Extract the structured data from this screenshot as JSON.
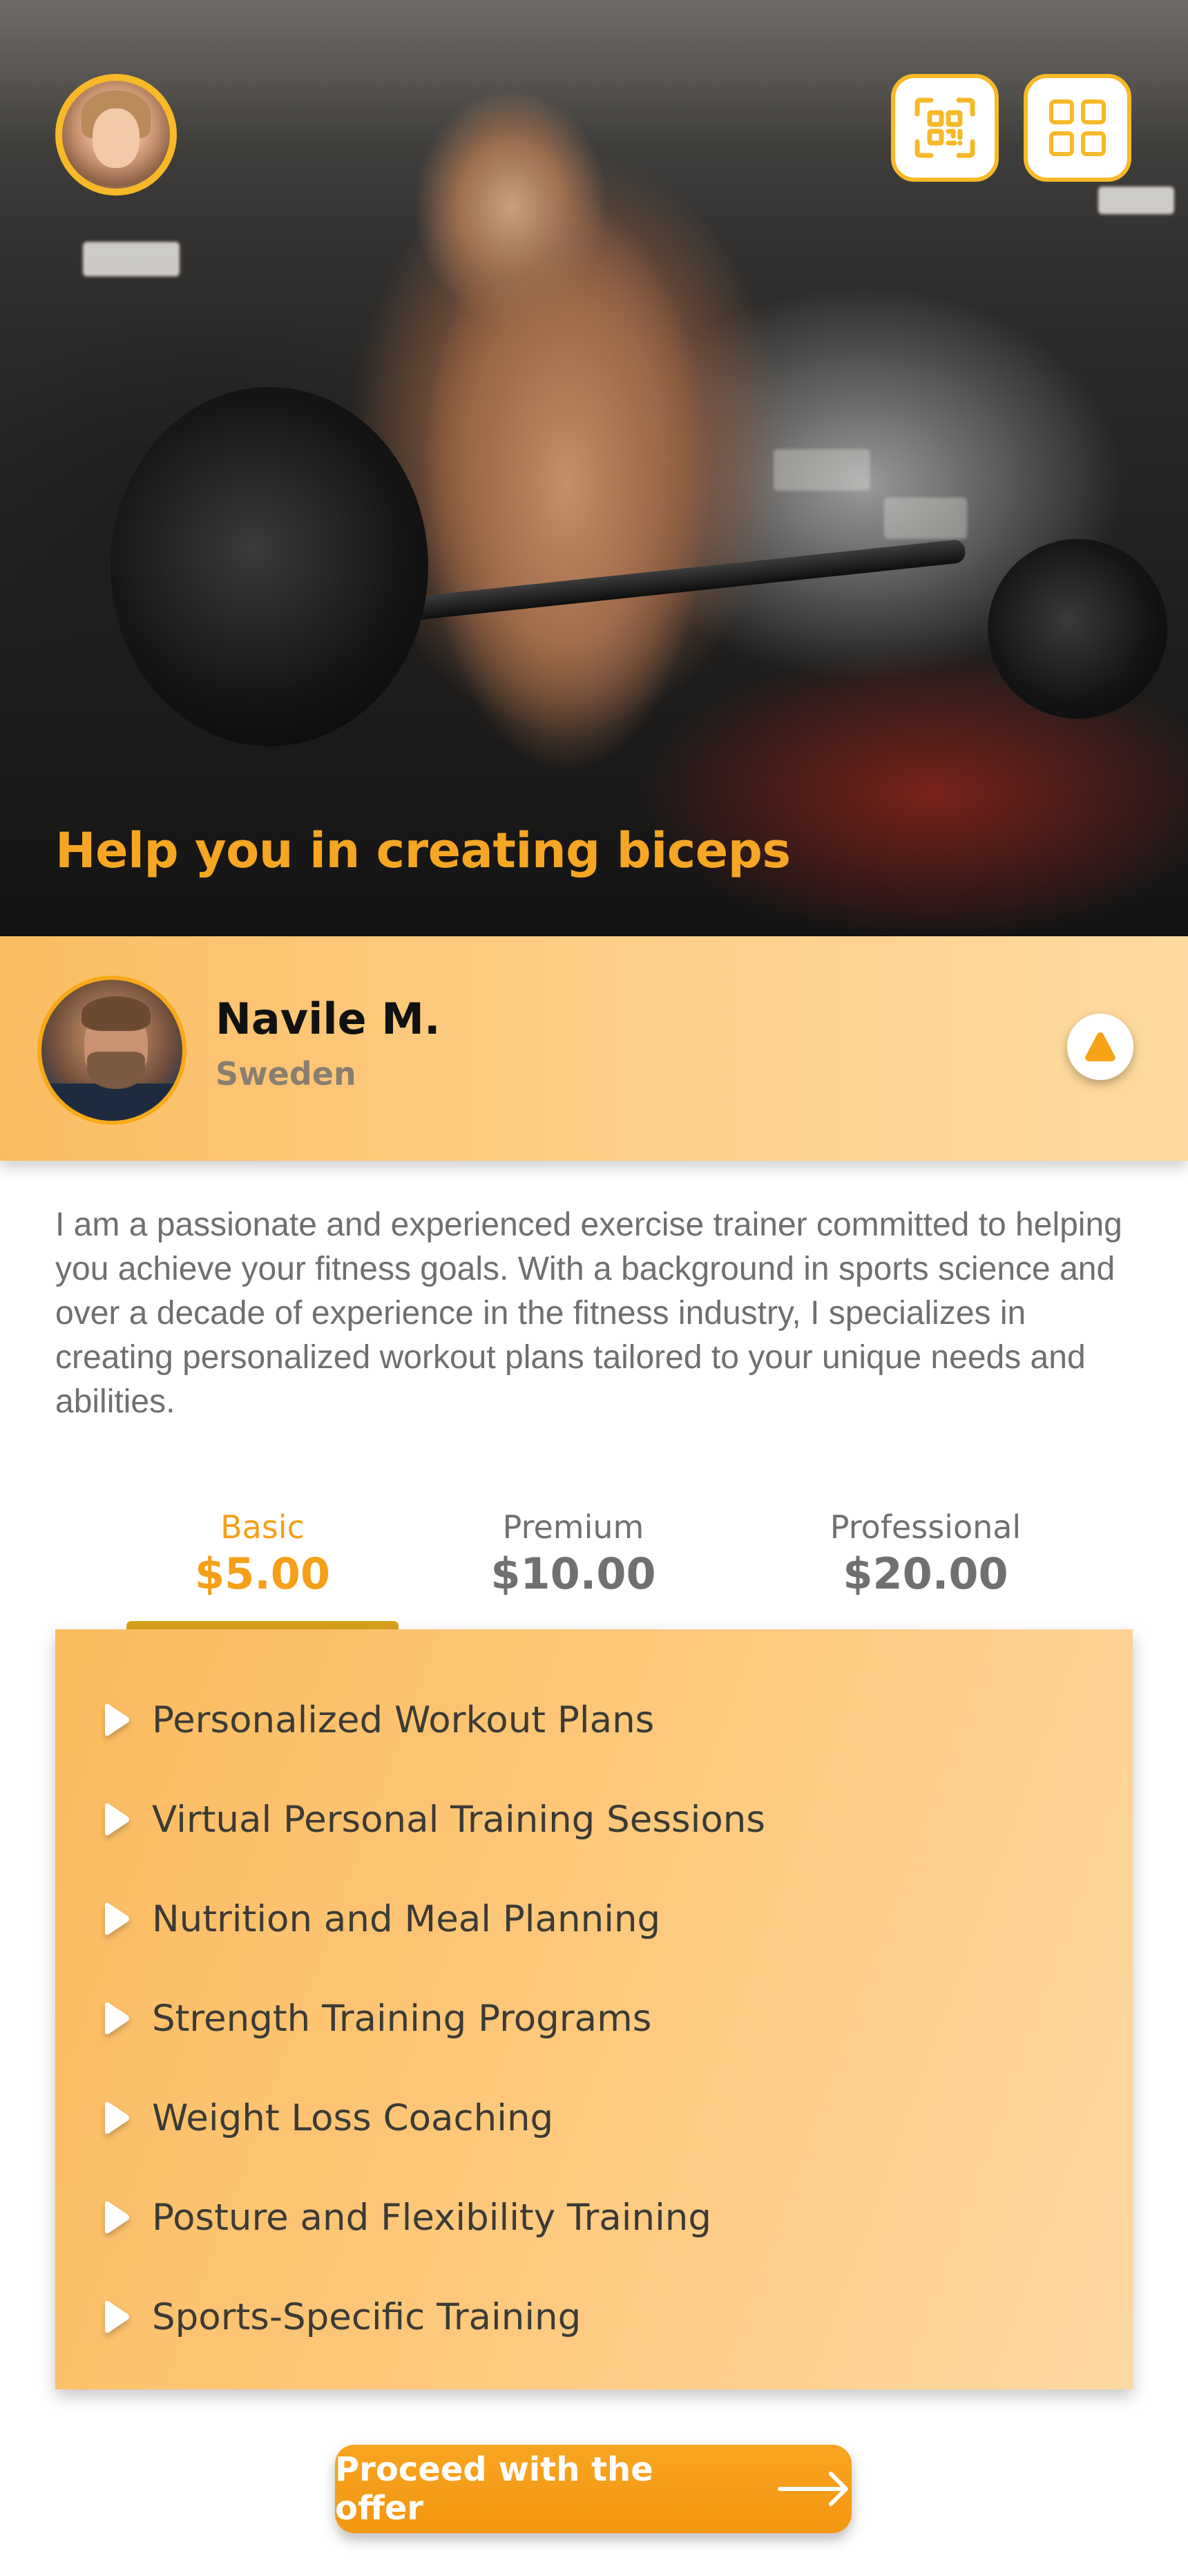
{
  "hero": {
    "title": "Help you in creating biceps",
    "accent_color": "#f5a623"
  },
  "header": {
    "qr_icon": "qr-code-icon",
    "menu_icon": "grid-menu-icon",
    "accent_color": "#f7b927"
  },
  "trainer": {
    "name": "Navile M.",
    "country": "Sweden",
    "collapse_icon": "triangle-up-icon"
  },
  "bio": "I am a passionate and experienced exercise trainer committed to helping you achieve your fitness goals. With a background in sports science and over a decade of experience in the fitness industry, I specializes in creating personalized workout plans tailored to your unique needs and abilities.",
  "plans": [
    {
      "name": "Basic",
      "price": "$5.00",
      "active": true
    },
    {
      "name": "Premium",
      "price": "$10.00",
      "active": false
    },
    {
      "name": "Professional",
      "price": "$20.00",
      "active": false
    }
  ],
  "features": [
    "Personalized Workout Plans",
    "Virtual Personal Training Sessions",
    "Nutrition and Meal Planning",
    "Strength Training Programs",
    "Weight Loss Coaching",
    "Posture and Flexibility Training",
    "Sports-Specific Training"
  ],
  "cta": {
    "label": "Proceed with the offer",
    "icon": "arrow-right-icon"
  }
}
